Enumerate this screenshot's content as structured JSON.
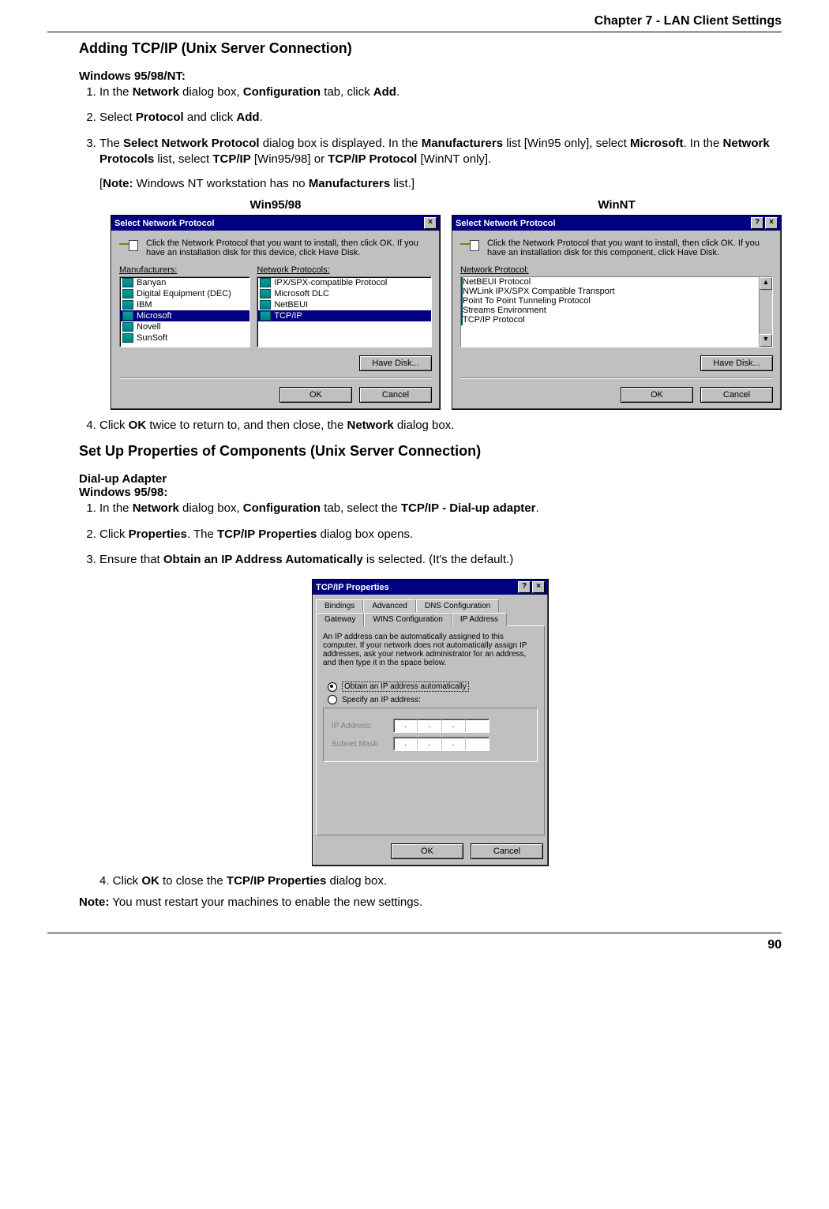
{
  "chapter": "Chapter 7 - LAN Client Settings",
  "page_number": "90",
  "section1": {
    "title": "Adding TCP/IP (Unix Server Connection)",
    "oslabel": "Windows 95/98/NT:",
    "steps": [
      "In the <b>Network</b> dialog box, <b>Configuration</b> tab, click <b>Add</b>.",
      "Select <b>Protocol</b> and click <b>Add</b>.",
      "The <b>Select Network Protocol</b> dialog box is displayed. In the <b>Manufacturers</b> list [Win95 only], select <b>Microsoft</b>. In the <b>Network Protocols</b> list, select <b>TCP/IP</b> [Win95/98] or <b>TCP/IP Protocol</b> [WinNT only]."
    ],
    "note_after3": "[<b>Note:</b> Windows NT workstation has no <b>Manufacturers</b> list.]",
    "shot95_label": "Win95/98",
    "shotnt_label": "WinNT",
    "step4": " Click <b>OK</b> twice to return to, and then close, the <b>Network</b> dialog box."
  },
  "dlg95": {
    "title": "Select Network Protocol",
    "instr": "Click the Network Protocol that you want to install, then click OK. If you have an installation disk for this device, click Have Disk.",
    "manuf_label": "Manufacturers:",
    "proto_label": "Network Protocols:",
    "manufacturers": [
      "Banyan",
      "Digital Equipment (DEC)",
      "IBM",
      "Microsoft",
      "Novell",
      "SunSoft"
    ],
    "manuf_selected": 3,
    "protocols": [
      "IPX/SPX-compatible Protocol",
      "Microsoft DLC",
      "NetBEUI",
      "TCP/IP"
    ],
    "proto_selected": 3,
    "have_disk": "Have Disk...",
    "ok": "OK",
    "cancel": "Cancel"
  },
  "dlgnt": {
    "title": "Select Network Protocol",
    "instr": "Click the Network Protocol that you want to install, then click OK. If you have an installation disk for this component, click Have Disk.",
    "proto_label": "Network Protocol:",
    "protocols": [
      "NetBEUI Protocol",
      "NWLink IPX/SPX Compatible Transport",
      "Point To Point Tunneling Protocol",
      "Streams Environment",
      "TCP/IP Protocol"
    ],
    "proto_selected": 4,
    "have_disk": "Have Disk...",
    "ok": "OK",
    "cancel": "Cancel"
  },
  "section2": {
    "title": "Set Up Properties of Components (Unix Server Connection)",
    "sub1": "Dial-up Adapter",
    "sub2": "Windows 95/98:",
    "steps": [
      "In the <b>Network</b> dialog box, <b>Configuration</b> tab, select the <b>TCP/IP - Dial-up adapter</b>.",
      "Click <b>Properties</b>. The <b>TCP/IP Properties</b> dialog box opens.",
      "Ensure that <b>Obtain an IP Address Automatically</b> is selected. (It's the default.)"
    ],
    "step4": "4. Click <b>OK</b> to close the <b>TCP/IP Properties</b> dialog box.",
    "final_note": "<b>Note:</b> You must restart your machines to enable the new settings."
  },
  "dlgprops": {
    "title": "TCP/IP Properties",
    "tabs_back": [
      "Bindings",
      "Advanced",
      "DNS Configuration"
    ],
    "tabs_front": [
      "Gateway",
      "WINS Configuration",
      "IP Address"
    ],
    "active_tab": "IP Address",
    "desc": "An IP address can be automatically assigned to this computer. If your network does not automatically assign IP addresses, ask your network administrator for an address, and then type it in the space below.",
    "radio1": "Obtain an IP address automatically",
    "radio2": "Specify an IP address:",
    "ip_label": "IP Address:",
    "mask_label": "Subnet Mask:",
    "ok": "OK",
    "cancel": "Cancel"
  }
}
